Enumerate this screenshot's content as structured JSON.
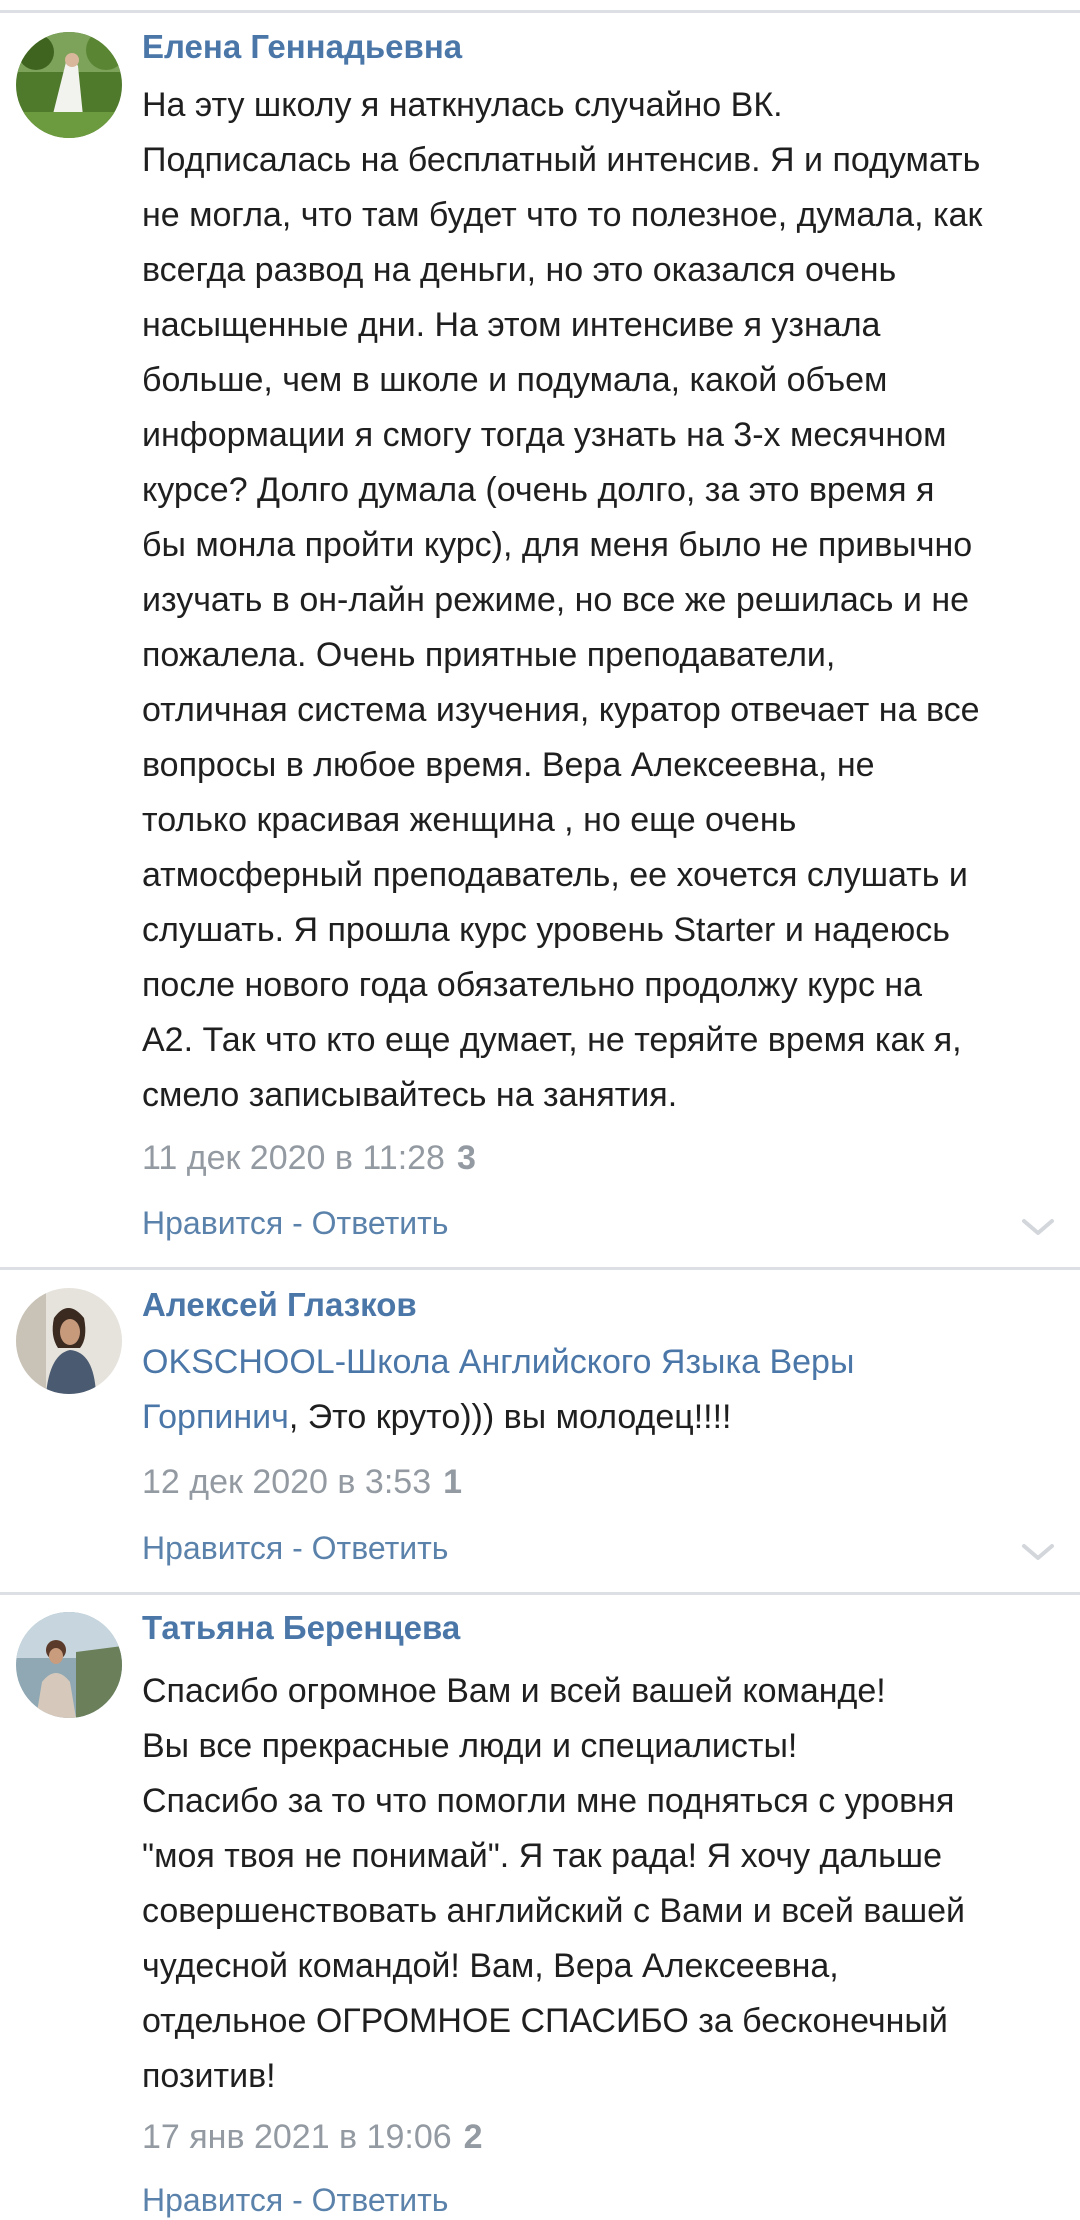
{
  "comments": [
    {
      "author": "Елена Геннадьевна",
      "avatar_icon": "bride-photo-avatar",
      "lines": [
        "На эту школу я наткнулась случайно ВК.",
        "Подписалась на бесплатный интенсив. Я и подумать",
        "не могла, что там будет что то полезное, думала, как",
        "всегда развод на деньги, но это оказался очень",
        "насыщенные дни. На этом интенсиве я узнала",
        "больше, чем в школе и подумала, какой объем",
        "информации я смогу тогда узнать на 3-х месячном",
        "курсе? Долго думала (очень долго, за это время я",
        "бы монла пройти курс), для меня было не привычно",
        "изучать в он-лайн режиме, но все же решилась и не",
        "пожалела. Очень приятные преподаватели,",
        "отличная система изучения, куратор отвечает на все",
        "вопросы в любое время. Вера Алексеевна, не",
        "только красивая женщина , но еще очень",
        "атмосферный преподаватель, ее хочется слушать и",
        "слушать. Я прошла курс уровень Starter и надеюсь",
        "после нового года обязательно продолжу курс на",
        "А2. Так что кто еще думает, не теряйте время как я,",
        "смело записывайтесь на занятия."
      ],
      "date": "11 дек 2020 в 11:28",
      "likes": "3",
      "like_label": "Нравится",
      "separator": " - ",
      "reply_label": "Ответить"
    },
    {
      "author": "Алексей Глазков",
      "avatar_icon": "man-photo-avatar",
      "mention_line1": "OKSCHOOL-Школа Английского Языка Веры",
      "mention_line2": "Горпинич",
      "text_after_mention": ", Это круто))) вы молодец!!!!",
      "date": "12 дек 2020 в 3:53",
      "likes": "1",
      "like_label": "Нравится",
      "separator": " - ",
      "reply_label": "Ответить"
    },
    {
      "author": "Татьяна Беренцева",
      "avatar_icon": "woman-photo-avatar",
      "lines": [
        "Спасибо огромное Вам и всей вашей команде!",
        "Вы все прекрасные люди и специалисты!",
        "Спасибо за то что помогли мне подняться с уровня",
        "\"моя твоя не понимай\". Я так рада! Я хочу дальше",
        "совершенствовать английский с Вами и всей вашей",
        "чудесной командой! Вам, Вера Алексеевна,",
        "отдельное ОГРОМНОЕ СПАСИБО за бесконечный",
        "позитив!"
      ],
      "date": "17 янв 2021 в 19:06",
      "likes": "2",
      "like_label": "Нравится",
      "separator": " - ",
      "reply_label": "Ответить"
    }
  ],
  "colors": {
    "link": "#4a76a8",
    "meta": "#939aa2",
    "text": "#1f1f1f",
    "divider": "#dcdfe3"
  }
}
